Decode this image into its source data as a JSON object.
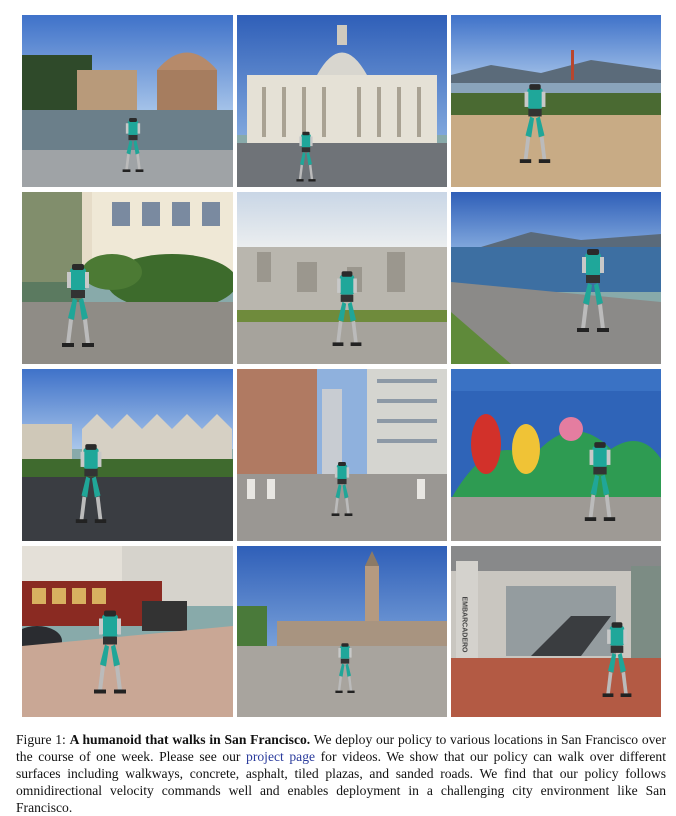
{
  "figure": {
    "images": [
      {
        "scene": "palace-of-fine-arts-lagoon",
        "row": 1,
        "col": 1
      },
      {
        "scene": "city-hall-plaza",
        "row": 1,
        "col": 2
      },
      {
        "scene": "sandy-path-golden-gate-bridge",
        "row": 1,
        "col": 3
      },
      {
        "scene": "victorian-house-garden-sidewalk",
        "row": 2,
        "col": 1
      },
      {
        "scene": "hilltop-park-city-view",
        "row": 2,
        "col": 2
      },
      {
        "scene": "bay-shore-walkway",
        "row": 2,
        "col": 3
      },
      {
        "scene": "painted-ladies-asphalt-road",
        "row": 3,
        "col": 1
      },
      {
        "scene": "downtown-crosswalk",
        "row": 3,
        "col": 2
      },
      {
        "scene": "mural-wall-sidewalk",
        "row": 3,
        "col": 3
      },
      {
        "scene": "cable-car-tiled-sidewalk",
        "row": 4,
        "col": 1
      },
      {
        "scene": "ferry-building-plaza",
        "row": 4,
        "col": 2
      },
      {
        "scene": "embarcadero-station-entrance",
        "row": 4,
        "col": 3
      }
    ],
    "caption": {
      "label": "Figure 1: ",
      "title": "A humanoid that walks in San Francisco.",
      "text_before_link": " We deploy our policy to various locations in San Francisco over the course of one week. Please see our ",
      "link_text": "project page",
      "text_after_link": " for videos. We show that our policy can walk over different surfaces including walkways, concrete, asphalt, tiled plazas, and sanded roads. We find that our policy follows omnidirectional velocity commands well and enables deployment in a challenging city environment like San Francisco."
    },
    "sign_text": "EMBARCADERO"
  }
}
